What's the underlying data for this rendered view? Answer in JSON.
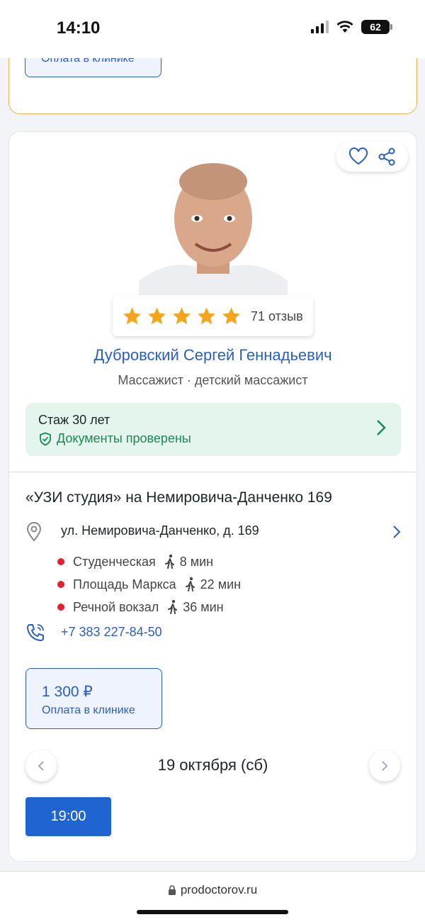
{
  "status": {
    "time": "14:10",
    "battery": "62"
  },
  "prev_card": {
    "pay_label": "Оплата в клинике"
  },
  "doctor": {
    "rating_count": "71 отзыв",
    "stars": 5,
    "name": "Дубровский Сергей Геннадьевич",
    "specialty": "Массажист · детский массажист",
    "experience": "Стаж 30 лет",
    "documents": "Документы проверены"
  },
  "clinic": {
    "name": "«УЗИ студия» на Немировича-Данченко 169",
    "address": "ул. Немировича-Данченко, д. 169",
    "metro": [
      {
        "station": "Студенческая",
        "time": "8 мин"
      },
      {
        "station": "Площадь Маркса",
        "time": "22 мин"
      },
      {
        "station": "Речной вокзал",
        "time": "36 мин"
      }
    ],
    "phone": "+7 383 227-84-50"
  },
  "price": {
    "amount": "1 300 ₽",
    "pay_label": "Оплата в клинике"
  },
  "schedule": {
    "date": "19 октября (сб)",
    "slots": [
      "19:00"
    ]
  },
  "browser": {
    "url": "prodoctorov.ru"
  },
  "colors": {
    "accent": "#2b5fbf",
    "button": "#2064d2",
    "success": "#1a8a52",
    "metro": "#e4202e",
    "star": "#f4a51c"
  }
}
